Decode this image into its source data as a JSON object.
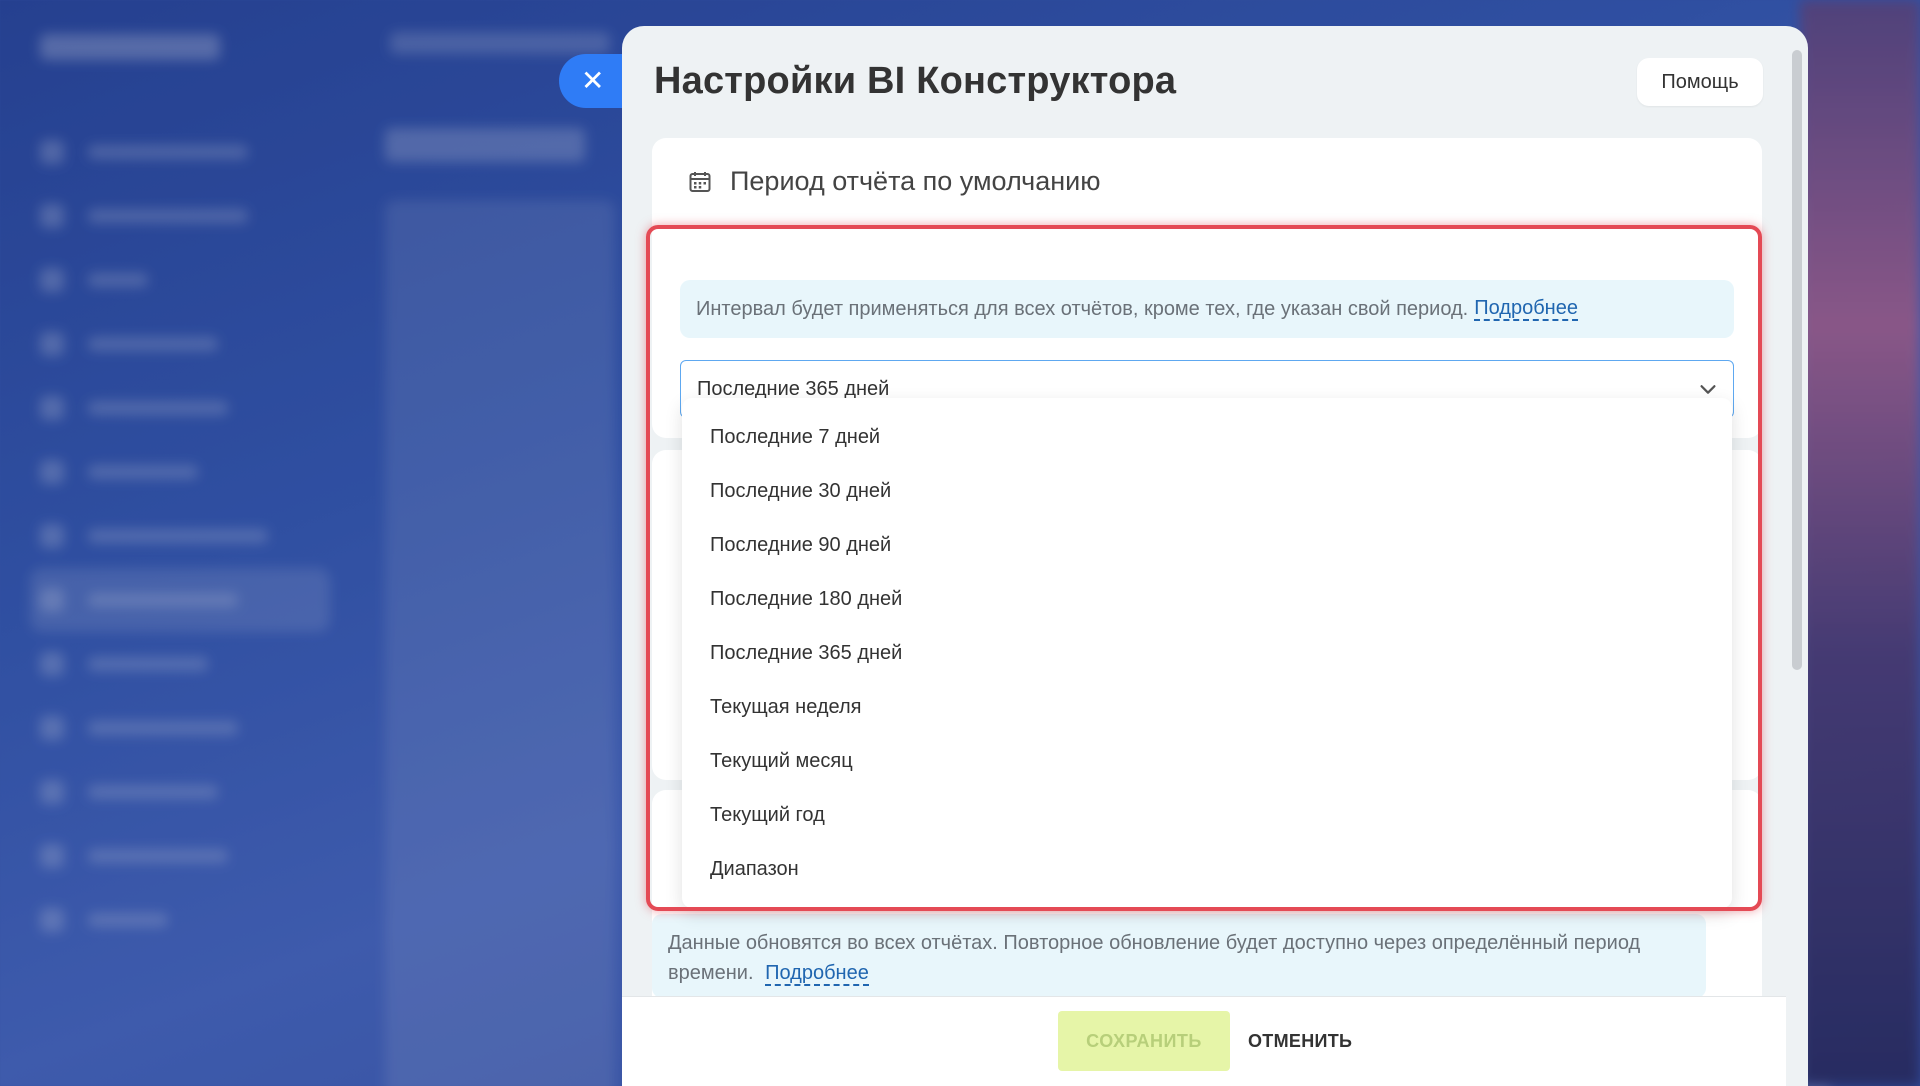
{
  "panel": {
    "title": "Настройки BI Конструктора",
    "help_label": "Помощь",
    "close_label": "✕"
  },
  "period_card": {
    "title": "Период отчёта по умолчанию",
    "info_text": "Интервал будет применяться для всех отчётов, кроме тех, где указан свой период.",
    "info_link": "Подробнее",
    "selected_value": "Последние 365 дней"
  },
  "dropdown": {
    "options": [
      "Последние 7 дней",
      "Последние 30 дней",
      "Последние 90 дней",
      "Последние 180 дней",
      "Последние 365 дней",
      "Текущая неделя",
      "Текущий месяц",
      "Текущий год",
      "Диапазон"
    ]
  },
  "refresh_card": {
    "info_text": "Данные обновятся во всех отчётах. Повторное обновление будет доступно через определённый период времени.",
    "info_link": "Подробнее"
  },
  "footer": {
    "save_label": "СОХРАНИТЬ",
    "cancel_label": "ОТМЕНИТЬ"
  },
  "colors": {
    "accent": "#2f7cf6",
    "highlight": "#e44a55",
    "save_disabled_bg": "#e6f5a8",
    "link": "#2066b0"
  }
}
